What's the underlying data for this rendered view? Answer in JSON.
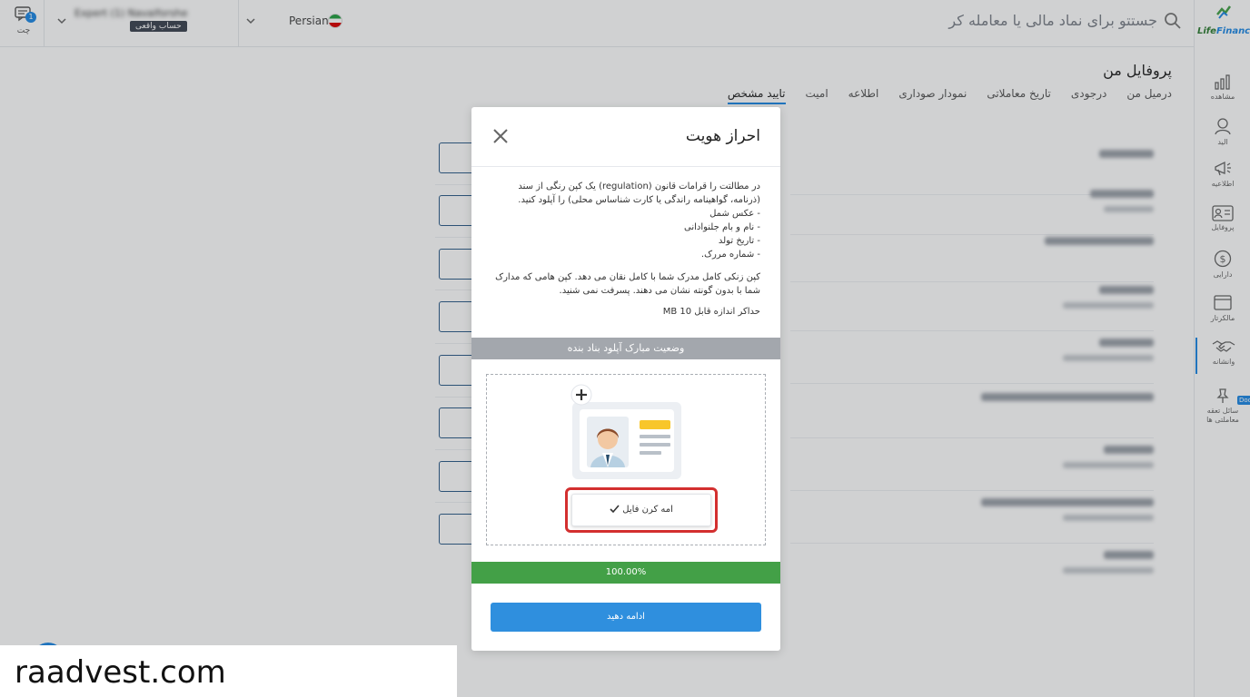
{
  "topbar": {
    "chat_label": "چت",
    "chat_count": "1",
    "account_name": "Expert (1) Navaiforshe",
    "account_type": "حساب واقعی",
    "language": "Persian",
    "search_placeholder": "جستتو برای نماد مالی یا معامله کر"
  },
  "brand": {
    "name_a": "Life",
    "name_b": "Finance"
  },
  "sidebar": {
    "items": [
      {
        "label": "مشاهده",
        "icon": "chart-icon"
      },
      {
        "label": "الید",
        "icon": "user-icon"
      },
      {
        "label": "اطلاعیه",
        "icon": "megaphone-icon"
      },
      {
        "label": "پروفایل",
        "icon": "id-card-icon"
      },
      {
        "label": "دارایی",
        "icon": "dollar-icon"
      },
      {
        "label": "مالکرتار",
        "icon": "window-icon"
      },
      {
        "label": "وانشانه",
        "icon": "handshake-icon"
      },
      {
        "label": "سائل تعقه معاملتی ها",
        "icon": "pin-icon"
      }
    ],
    "doc_tag": "Doc"
  },
  "page": {
    "title": "پروفایل من",
    "tabs": [
      "درمیل من",
      "درجودی",
      "تاریخ معاملاتی",
      "نمودار صوداری",
      "اطلاعه",
      "امیت",
      "تایید مشخص"
    ],
    "active_tab": "تایید مشخص"
  },
  "modal": {
    "title": "احراز هویت",
    "intro": "در مطالتت را قرامات قانون (regulation) یک کپن رنگی از سند (ذرنامه، گواهینامه راندگی یا کارت شناساس محلی) را آپلود کنید.",
    "requirements": [
      "- عکس شمل",
      "- نام و بام جلنوادانی",
      "- تاریخ تولد",
      "- شماره مررک."
    ],
    "note": "کپن زنکی کامل مدرک شما با کامل نقان می دهد. کپن هامی که مدارک شما با بدون گونته نشان می دهند. پسرفت نمی شنید.",
    "max_size": "حداکر اندازه قابل MB 10",
    "status_label": "وضعیت مبارک آپلود بناد بنده",
    "choose_file_label": "امه کرن فایل",
    "progress_text": "100.00%",
    "progress_value": 1.0,
    "continue_label": "ادامه دهید"
  },
  "watermark": "raadvest.com",
  "colors": {
    "accent": "#1e88e5",
    "progress": "#43a047",
    "highlight": "#d32f2f",
    "status_bar": "#a3a7ad"
  }
}
